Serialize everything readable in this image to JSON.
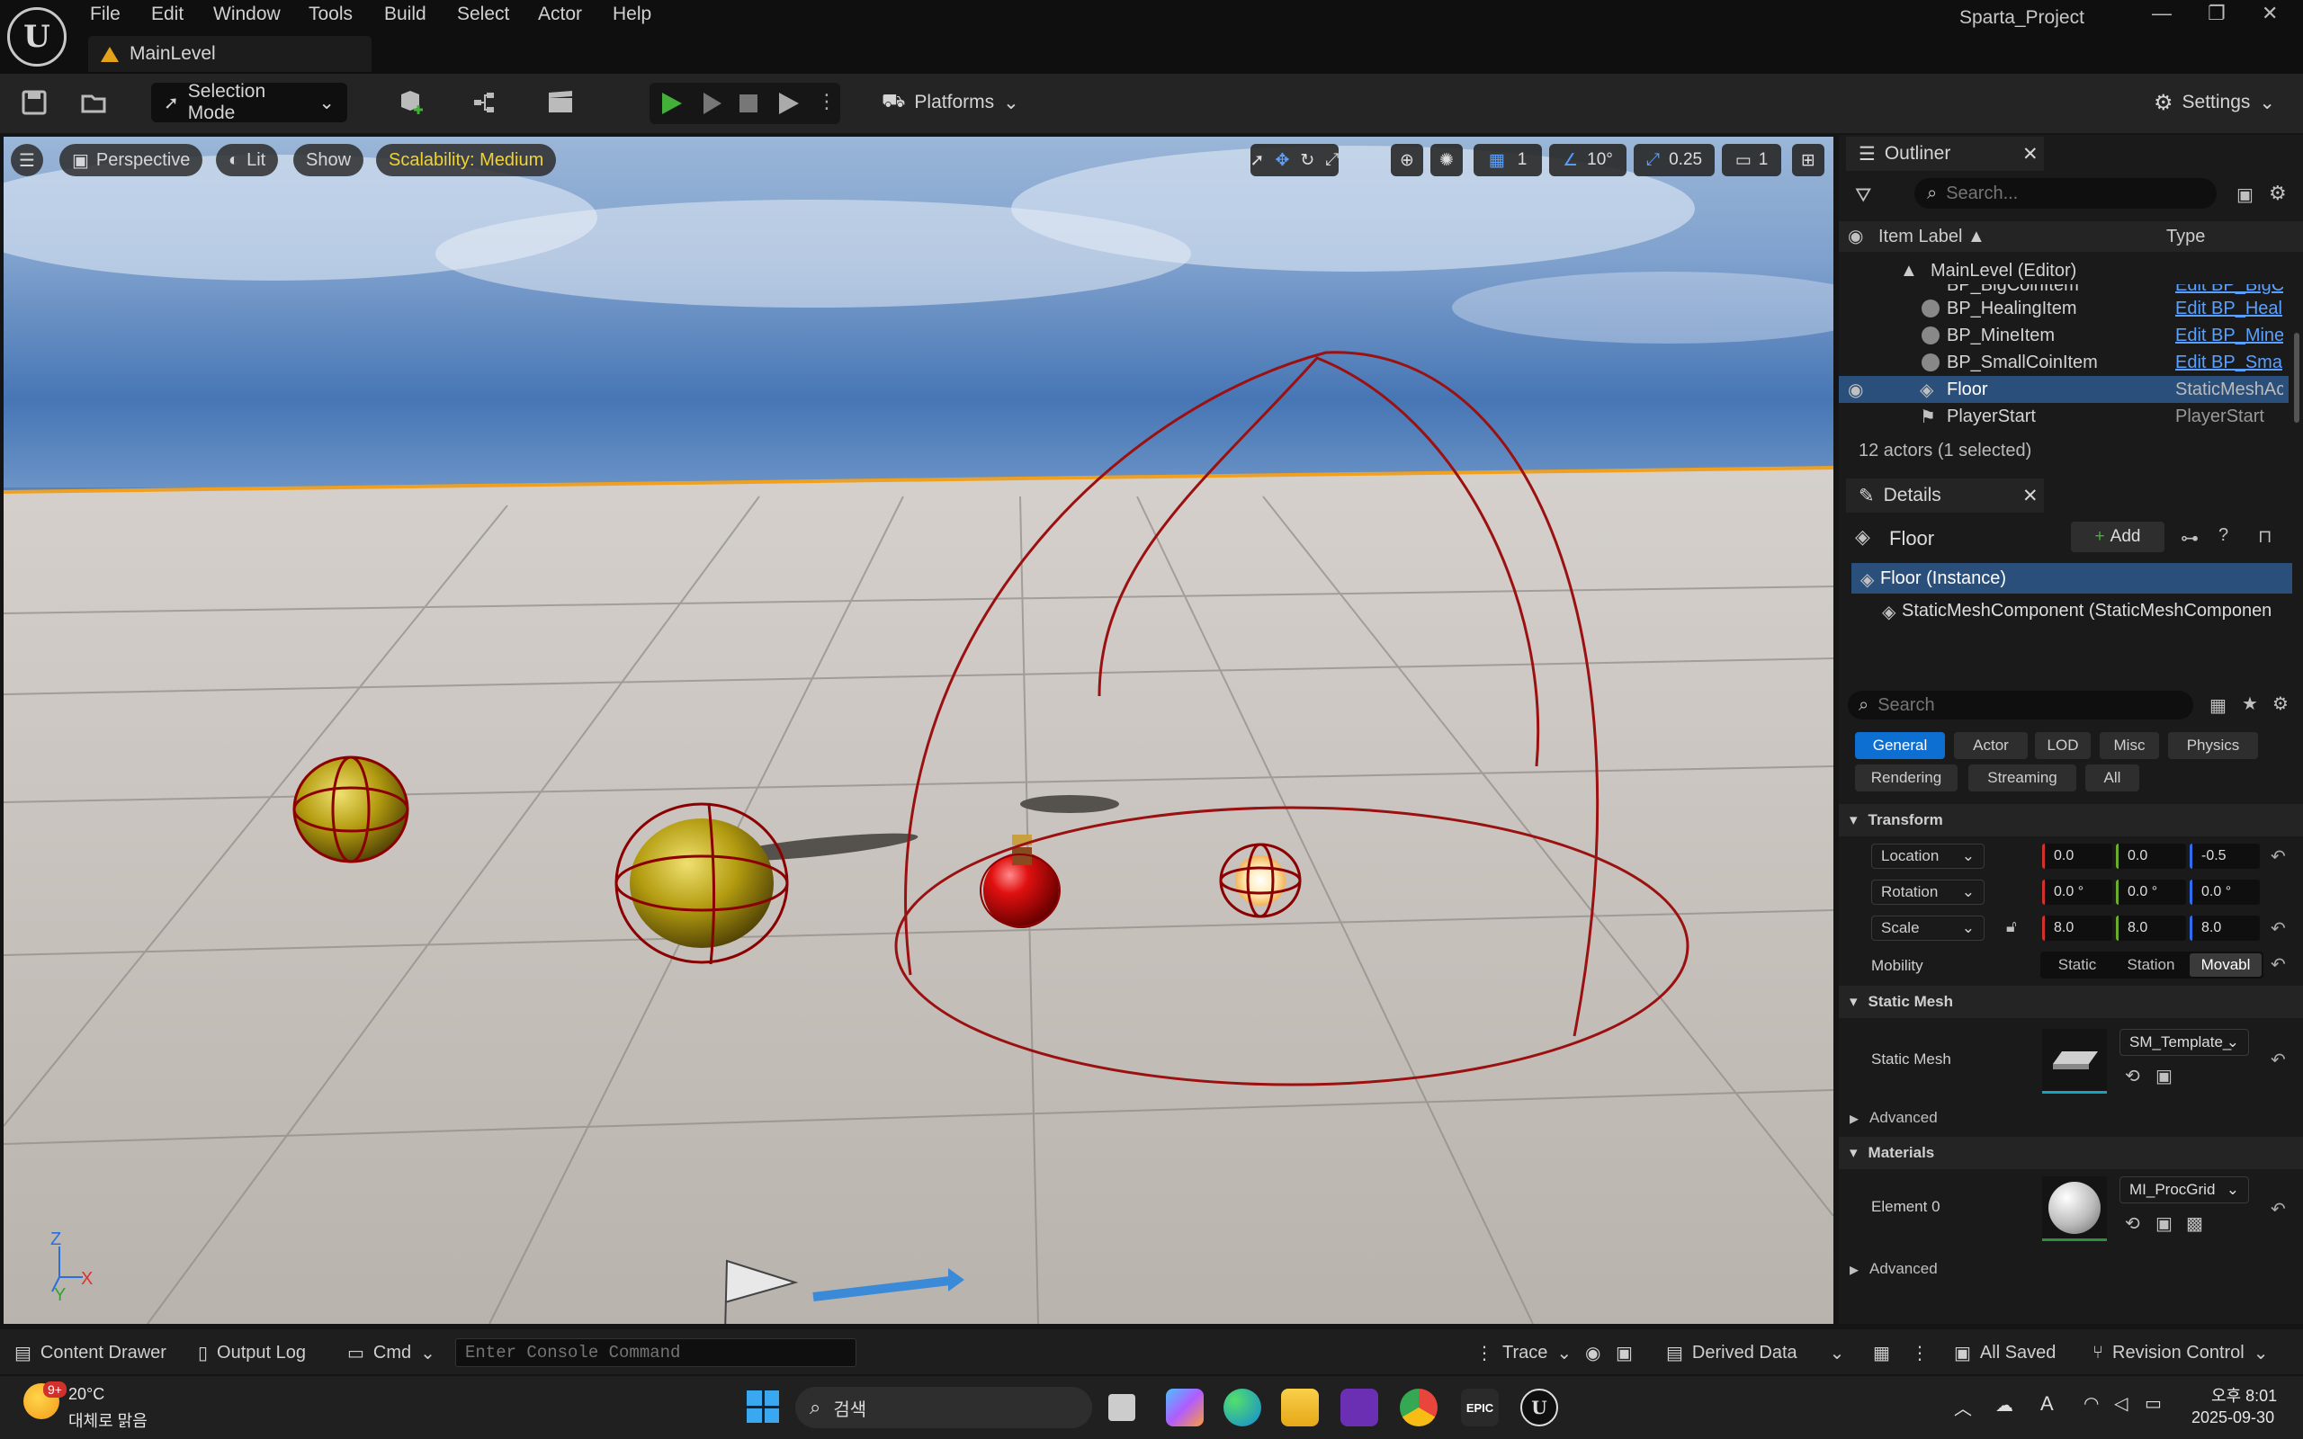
{
  "menubar": {
    "items": [
      "File",
      "Edit",
      "Window",
      "Tools",
      "Build",
      "Select",
      "Actor",
      "Help"
    ],
    "project": "Sparta_Project",
    "level_tab": "MainLevel"
  },
  "toolbar": {
    "mode": "Selection Mode",
    "platforms": "Platforms",
    "settings": "Settings"
  },
  "viewport": {
    "perspective": "Perspective",
    "lit": "Lit",
    "show": "Show",
    "scalability": "Scalability: Medium",
    "grid": "1",
    "angle": "10°",
    "scale": "0.25",
    "camera": "1",
    "axis_z": "Z",
    "axis_x": "X",
    "axis_y": "Y"
  },
  "outliner": {
    "tab": "Outliner",
    "search_placeholder": "Search...",
    "col_label": "Item Label ▲",
    "col_type": "Type",
    "root": "MainLevel (Editor)",
    "items": [
      {
        "label": "BP_BigCoinItem",
        "type": "Edit BP_BigCo"
      },
      {
        "label": "BP_HealingItem",
        "type": "Edit BP_Heal"
      },
      {
        "label": "BP_MineItem",
        "type": "Edit BP_Mine"
      },
      {
        "label": "BP_SmallCoinItem",
        "type": "Edit BP_Sma"
      },
      {
        "label": "Floor",
        "type": "StaticMeshAc"
      },
      {
        "label": "PlayerStart",
        "type": "PlayerStart"
      }
    ],
    "count": "12 actors (1 selected)"
  },
  "details": {
    "tab": "Details",
    "actor": "Floor",
    "add": "Add",
    "instance": "Floor (Instance)",
    "component": "StaticMeshComponent (StaticMeshComponen",
    "search_placeholder": "Search",
    "categories": [
      "General",
      "Actor",
      "LOD",
      "Misc",
      "Physics",
      "Rendering",
      "Streaming",
      "All"
    ],
    "transform": "Transform",
    "location": "Location",
    "rotation": "Rotation",
    "scale": "Scale",
    "mobility": "Mobility",
    "loc": [
      "0.0",
      "0.0",
      "-0.5"
    ],
    "rot": [
      "0.0 °",
      "0.0 °",
      "0.0 °"
    ],
    "scl": [
      "8.0",
      "8.0",
      "8.0"
    ],
    "mob": [
      "Static",
      "Station",
      "Movabl"
    ],
    "static_mesh_section": "Static Mesh",
    "static_mesh_label": "Static Mesh",
    "static_mesh_value": "SM_Template_",
    "advanced": "Advanced",
    "materials": "Materials",
    "element0": "Element 0",
    "material_value": "MI_ProcGrid"
  },
  "statusbar": {
    "content_drawer": "Content Drawer",
    "output_log": "Output Log",
    "cmd": "Cmd",
    "console_placeholder": "Enter Console Command",
    "trace": "Trace",
    "derived": "Derived Data",
    "saved": "All Saved",
    "revision": "Revision Control"
  },
  "taskbar": {
    "temp": "20°C",
    "weather": "대체로 맑음",
    "badge": "9+",
    "search": "검색",
    "time": "오후 8:01",
    "date": "2025-09-30"
  },
  "colors": {
    "accent": "#0d6fd1",
    "selection": "#2a4f7a",
    "play_green": "#43b139",
    "gizmo_red": "#9b1010"
  }
}
